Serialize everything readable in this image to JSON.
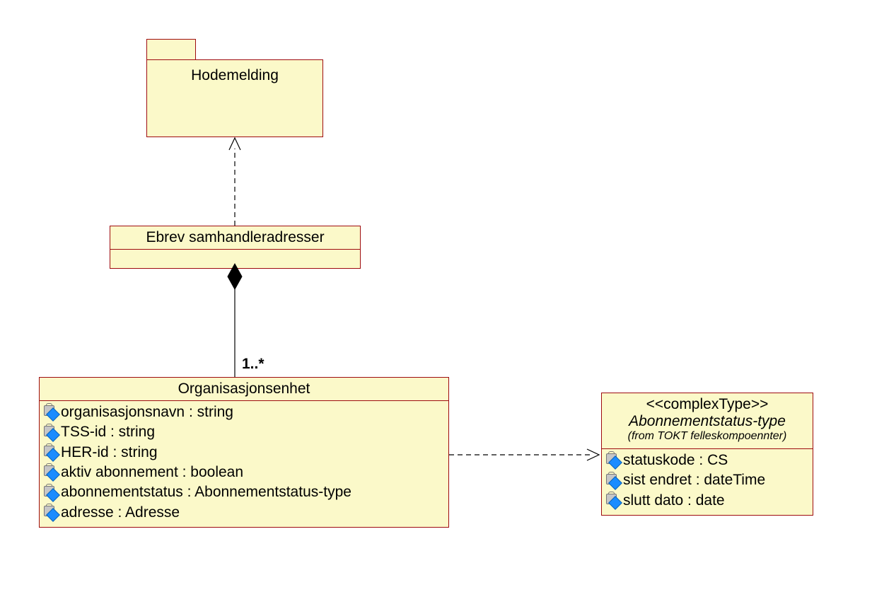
{
  "package": {
    "name": "Hodemelding"
  },
  "class_ebrev": {
    "name": "Ebrev samhandleradresser"
  },
  "class_org": {
    "name": "Organisasjonsenhet",
    "multiplicity": "1..*",
    "attrs": {
      "a1": "organisasjonsnavn : string",
      "a2": "TSS-id : string",
      "a3": "HER-id : string",
      "a4": "aktiv abonnement : boolean",
      "a5": "abonnementstatus : Abonnementstatus-type",
      "a6": "adresse : Adresse"
    }
  },
  "class_abon": {
    "stereotype": "<<complexType>>",
    "name": "Abonnementstatus-type",
    "from": "(from TOKT felleskompoennter)",
    "attrs": {
      "a1": "statuskode : CS",
      "a2": "sist endret : dateTime",
      "a3": "slutt dato : date"
    }
  }
}
